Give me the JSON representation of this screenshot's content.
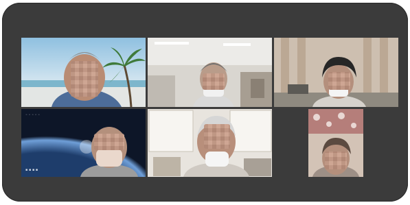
{
  "meeting": {
    "participants": [
      {
        "id": "p1",
        "background": "beach-palm",
        "face_obscured": true
      },
      {
        "id": "p2",
        "background": "office-ceiling",
        "face_obscured": true
      },
      {
        "id": "p3",
        "background": "office-curtain",
        "face_obscured": true
      },
      {
        "id": "p4",
        "background": "earth-from-space",
        "face_obscured": true
      },
      {
        "id": "p5",
        "background": "whiteboard-room",
        "face_obscured": true
      },
      {
        "id": "p6",
        "background": "room-flowers",
        "face_obscured": true
      }
    ]
  },
  "colors": {
    "frame": "#3b3b3b",
    "skin_mosaic": "#c89a85",
    "mask": "#f2f2f2"
  }
}
